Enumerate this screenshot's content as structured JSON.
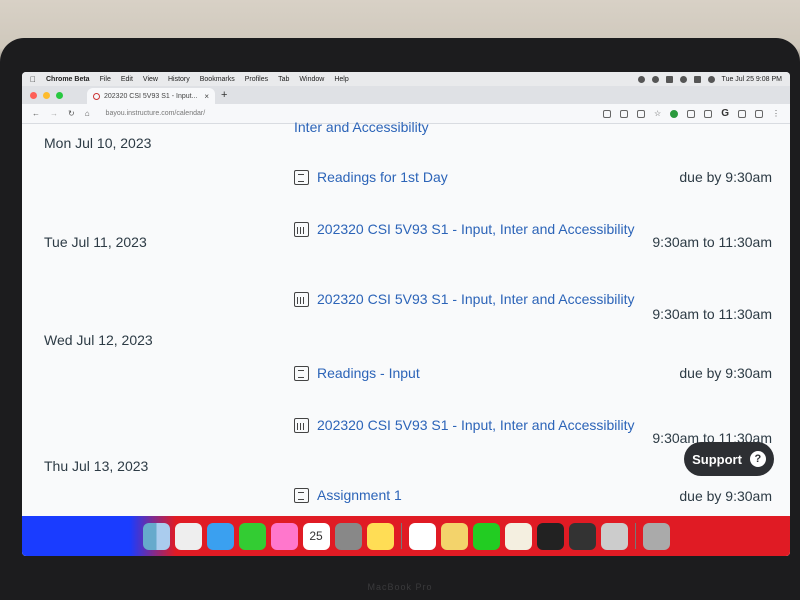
{
  "menubar": {
    "app_name": "Chrome Beta",
    "items": [
      "File",
      "Edit",
      "View",
      "History",
      "Bookmarks",
      "Profiles",
      "Tab",
      "Window",
      "Help"
    ],
    "clock": "Tue Jul 25 9:08 PM"
  },
  "browser": {
    "tab_title": "202320 CSI 5V93 S1 - Input...",
    "url": "bayou.instructure.com/calendar/"
  },
  "schedule": {
    "top_partial_item": "Inter and Accessibility",
    "days": [
      {
        "date": "Mon Jul 10, 2023"
      },
      {
        "date": "Tue Jul 11, 2023"
      },
      {
        "date": "Wed Jul 12, 2023"
      },
      {
        "date": "Thu Jul 13, 2023"
      }
    ],
    "items": [
      {
        "icon": "assignment-icon",
        "title": "Readings for 1st Day",
        "time": "due by 9:30am"
      },
      {
        "icon": "calendar-event-icon",
        "title": "202320 CSI 5V93 S1 - Input, Inter and Accessibility",
        "time": "9:30am to 11:30am"
      },
      {
        "icon": "calendar-event-icon",
        "title": "202320 CSI 5V93 S1 - Input, Inter and Accessibility",
        "time": "9:30am to 11:30am"
      },
      {
        "icon": "assignment-icon",
        "title": "Readings - Input",
        "time": "due by 9:30am"
      },
      {
        "icon": "calendar-event-icon",
        "title": "202320 CSI 5V93 S1 - Input, Inter and Accessibility",
        "time": "9:30am to 11:30am"
      },
      {
        "icon": "assignment-icon",
        "title": "Assignment 1",
        "time": "due by 9:30am"
      }
    ]
  },
  "support": {
    "label": "Support",
    "help_glyph": "?"
  },
  "dock": {
    "apps": [
      "finder-icon",
      "launchpad-icon",
      "safari-icon",
      "messages-icon",
      "photos-icon",
      "calendar-icon",
      "system-settings-icon",
      "notes-icon",
      "chrome-icon",
      "stickies-icon",
      "wechat-icon",
      "pencil-app-icon",
      "terminal-icon",
      "sublime-icon",
      "preview-icon",
      "trash-icon"
    ],
    "calendar_day": "25"
  },
  "laptop_label": "MacBook Pro",
  "colors": {
    "link": "#2c64b8",
    "text": "#2d3b45",
    "support_bg": "#2d2f33"
  }
}
